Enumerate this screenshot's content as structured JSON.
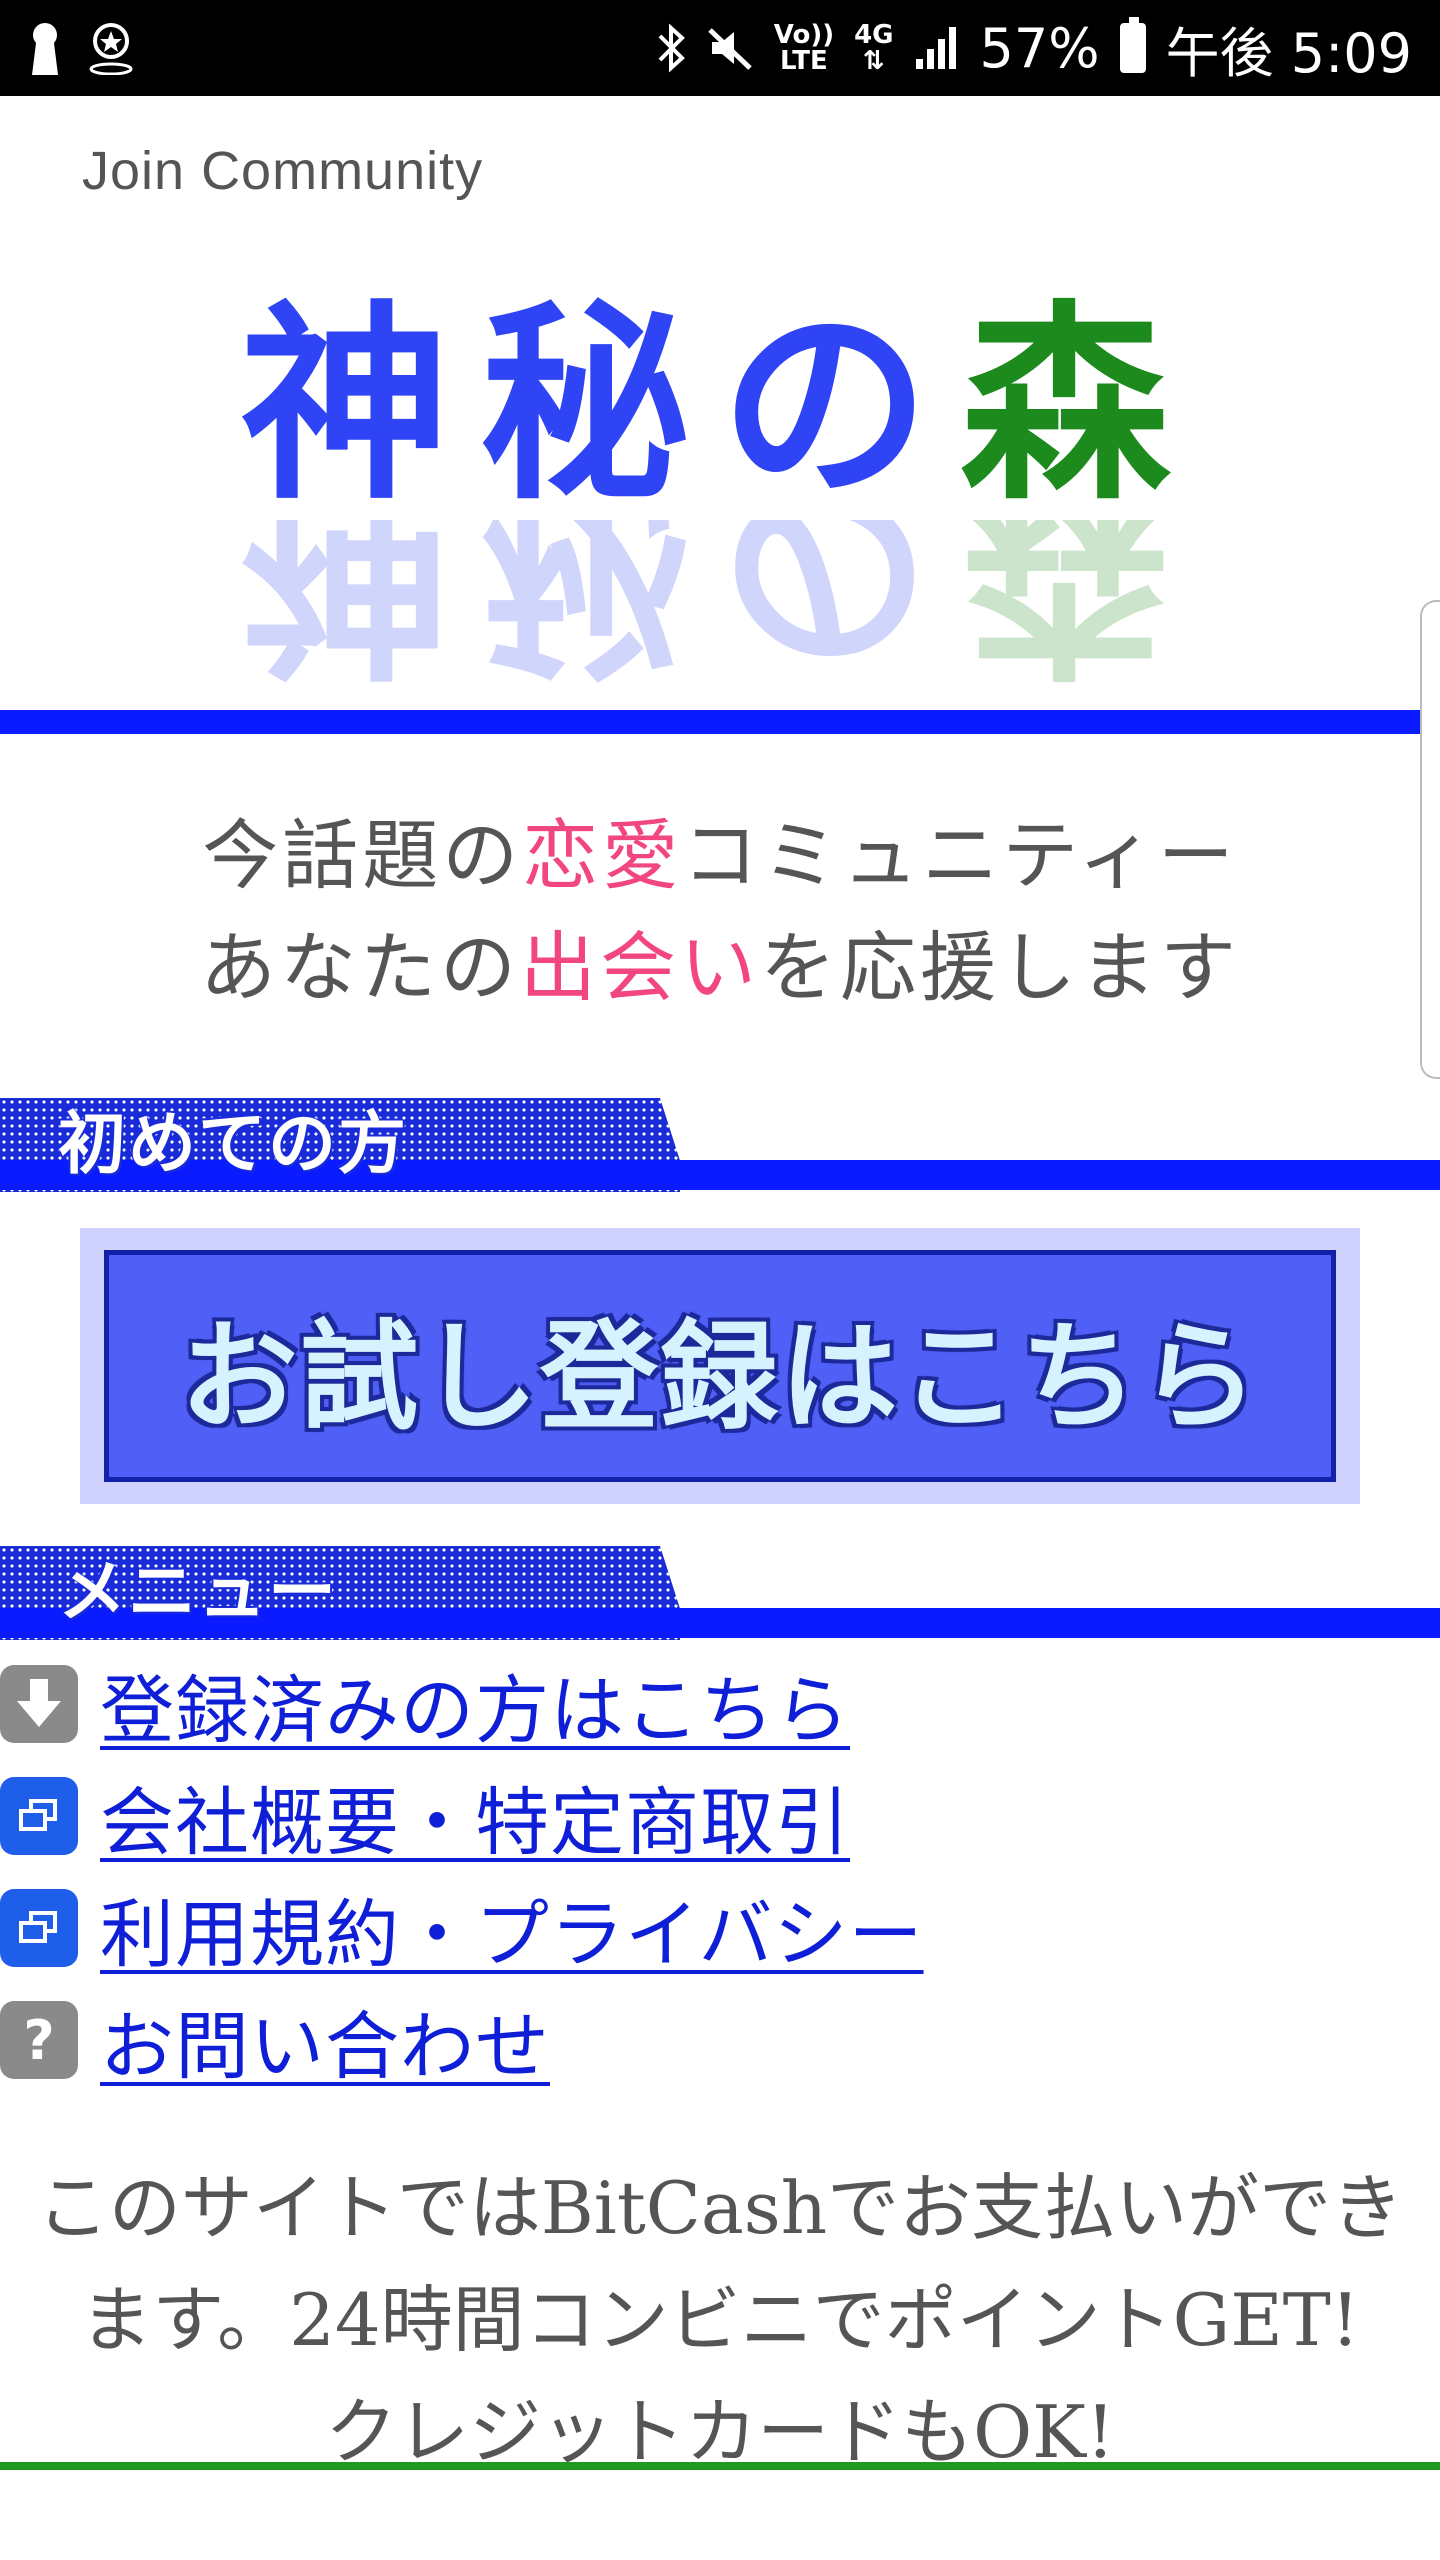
{
  "status_bar": {
    "left_icons": [
      "keyhole-icon",
      "location-badge-icon"
    ],
    "right_icons": [
      "bluetooth-icon",
      "mute-icon",
      "volte-icon",
      "4g-icon",
      "signal-icon",
      "battery-icon"
    ],
    "volte_label_top": "Vo))",
    "volte_label_bottom": "LTE",
    "net_label": "4G",
    "battery": "57%",
    "time": "午後 5:09"
  },
  "header": {
    "join_text": "Join Community",
    "logo": {
      "part1": "神秘の",
      "part2": "森",
      "colors": {
        "part1": "#2f44f5",
        "part2": "#1d8a1d"
      }
    },
    "accent_color": "#0a1cff"
  },
  "tagline": {
    "line1_a": "今話題の",
    "line1_pink": "恋愛",
    "line1_b": "コミュニティー",
    "line2_a": "あなたの",
    "line2_pink": "出会い",
    "line2_b": "を応援します",
    "pink_color": "#f2467f"
  },
  "section_first": {
    "title": "初めての方",
    "trial_button": "お試し登録はこちら"
  },
  "section_menu": {
    "title": "メニュー",
    "items": [
      {
        "label": "登録済みの方はこちら",
        "icon": "download-arrow-icon"
      },
      {
        "label": "会社概要・特定商取引",
        "icon": "window-icon"
      },
      {
        "label": "利用規約・プライバシー",
        "icon": "window-icon"
      },
      {
        "label": "お問い合わせ",
        "icon": "question-icon"
      }
    ]
  },
  "footer": {
    "line1": "このサイトではBitCashでお支払いができ",
    "line2": "ます。24時間コンビニでポイントGET!",
    "line3": "クレジットカードもOK!"
  }
}
